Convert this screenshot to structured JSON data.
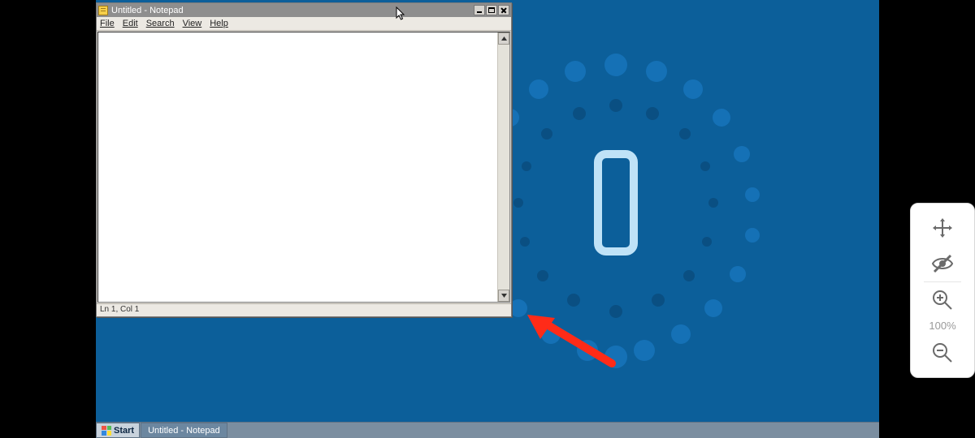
{
  "window": {
    "title": "Untitled - Notepad",
    "menu": {
      "file": "File",
      "edit": "Edit",
      "search": "Search",
      "view": "View",
      "help": "Help"
    },
    "status": "Ln 1, Col 1",
    "editor_text": ""
  },
  "taskbar": {
    "start_label": "Start",
    "task_label": "Untitled - Notepad"
  },
  "viewer_toolbar": {
    "zoom_label": "100%"
  }
}
